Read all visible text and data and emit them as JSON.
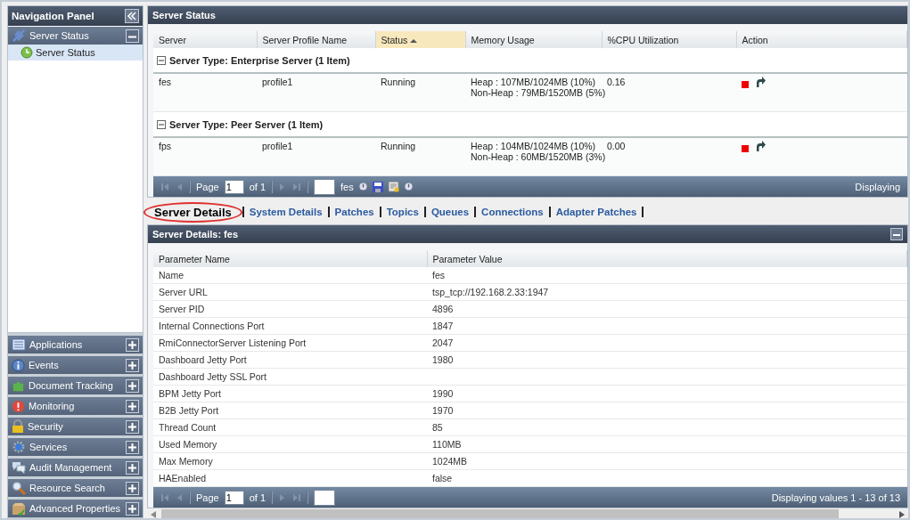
{
  "nav": {
    "title": "Navigation Panel",
    "sections": [
      {
        "label": "Server Status",
        "expanded": true,
        "children": [
          {
            "label": "Server Status",
            "selected": true
          }
        ]
      },
      {
        "label": "Applications",
        "expanded": false
      },
      {
        "label": "Events",
        "expanded": false
      },
      {
        "label": "Document Tracking",
        "expanded": false
      },
      {
        "label": "Monitoring",
        "expanded": false
      },
      {
        "label": "Security",
        "expanded": false
      },
      {
        "label": "Services",
        "expanded": false
      },
      {
        "label": "Audit Management",
        "expanded": false
      },
      {
        "label": "Resource Search",
        "expanded": false
      },
      {
        "label": "Advanced Properties",
        "expanded": false
      }
    ]
  },
  "server_status": {
    "title": "Server Status",
    "columns": [
      {
        "label": "Server",
        "sorted": false
      },
      {
        "label": "Server Profile Name",
        "sorted": false
      },
      {
        "label": "Status",
        "sorted": true
      },
      {
        "label": "Memory Usage",
        "sorted": false
      },
      {
        "label": "%CPU Utilization",
        "sorted": false
      },
      {
        "label": "Action",
        "sorted": false
      }
    ],
    "groups": [
      {
        "label": "Server Type: Enterprise Server (1 Item)",
        "expanded": true,
        "rows": [
          {
            "server": "fes",
            "profile": "profile1",
            "status": "Running",
            "memory": [
              "Heap : 107MB/1024MB (10%)",
              "Non-Heap : 79MB/1520MB (5%)"
            ],
            "cpu": "0.16"
          }
        ]
      },
      {
        "label": "Server Type: Peer Server (1 Item)",
        "expanded": true,
        "rows": [
          {
            "server": "fps",
            "profile": "profile1",
            "status": "Running",
            "memory": [
              "Heap : 104MB/1024MB (10%)",
              "Non-Heap : 60MB/1520MB (3%)"
            ],
            "cpu": "0.00"
          }
        ]
      }
    ],
    "pager": {
      "page_label": "Page",
      "page": "1",
      "of": "of 1",
      "filter_label": "fes",
      "display": "Displaying"
    }
  },
  "tabs": [
    {
      "label": "Server Details",
      "selected": true,
      "circled": true
    },
    {
      "label": "System Details",
      "selected": false,
      "circled": false
    },
    {
      "label": "Patches",
      "selected": false,
      "circled": false
    },
    {
      "label": "Topics",
      "selected": false,
      "circled": false
    },
    {
      "label": "Queues",
      "selected": false,
      "circled": false
    },
    {
      "label": "Connections",
      "selected": false,
      "circled": false
    },
    {
      "label": "Adapter Patches",
      "selected": false,
      "circled": false
    }
  ],
  "server_details": {
    "title": "Server Details: fes",
    "columns": [
      "Parameter Name",
      "Parameter Value"
    ],
    "rows": [
      [
        "Name",
        "fes"
      ],
      [
        "Server URL",
        "tsp_tcp://192.168.2.33:1947"
      ],
      [
        "Server PID",
        "4896"
      ],
      [
        "Internal Connections Port",
        "1847"
      ],
      [
        "RmiConnectorServer Listening Port",
        "2047"
      ],
      [
        "Dashboard Jetty Port",
        "1980"
      ],
      [
        "Dashboard Jetty SSL Port",
        ""
      ],
      [
        "BPM Jetty Port",
        "1990"
      ],
      [
        "B2B Jetty Port",
        "1970"
      ],
      [
        "Thread Count",
        "85"
      ],
      [
        "Used Memory",
        "110MB"
      ],
      [
        "Max Memory",
        "1024MB"
      ],
      [
        "HAEnabled",
        "false"
      ]
    ],
    "pager": {
      "page_label": "Page",
      "page": "1",
      "of": "of 1",
      "display": "Displaying values 1 - 13 of 13"
    }
  }
}
